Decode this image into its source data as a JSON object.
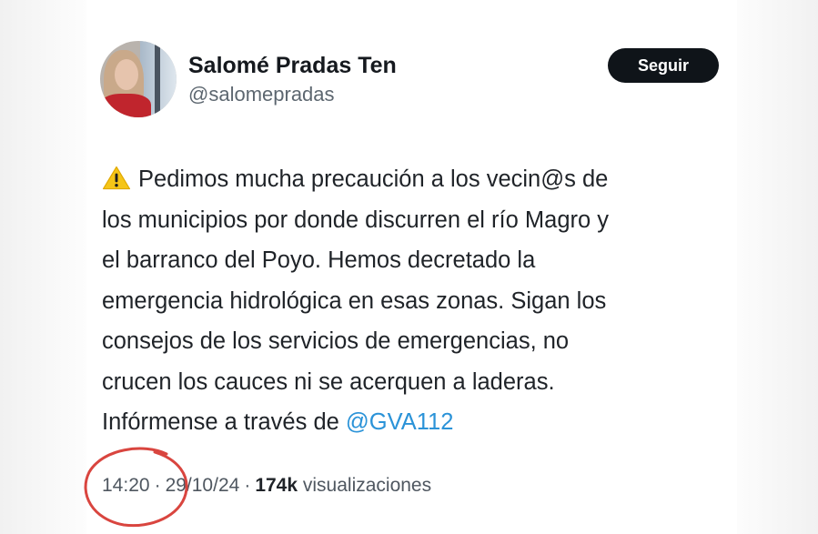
{
  "author": {
    "display_name": "Salomé Pradas Ten",
    "handle": "@salomepradas"
  },
  "follow_button_label": "Seguir",
  "tweet": {
    "lines": [
      "Pedimos mucha precaución a los vecin@s de",
      "los municipios por donde discurren el río Magro y",
      "el barranco del Poyo. Hemos decretado la",
      "emergencia hidrológica en esas zonas. Sigan los",
      "consejos de los servicios de emergencias, no",
      "crucen los cauces ni se acerquen a laderas."
    ],
    "last_line_prefix": "Infórmense a través de ",
    "mention": "@GVA112",
    "leading_icon": "warning-icon"
  },
  "meta": {
    "time": "14:20",
    "date": "29/10/24",
    "separator": "·",
    "views_count": "174k",
    "views_label": "visualizaciones"
  },
  "colors": {
    "mention": "#2b93d8",
    "follow_button_bg": "#0f1419",
    "annotation_circle": "#d9453f"
  }
}
